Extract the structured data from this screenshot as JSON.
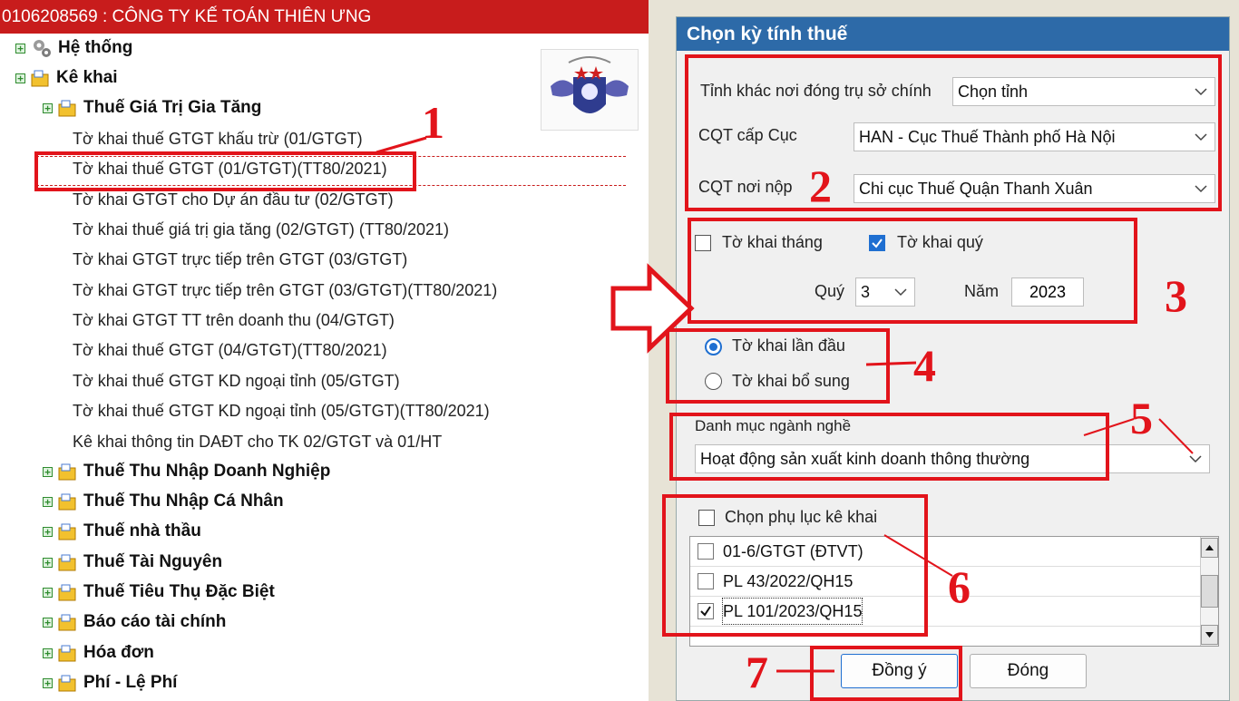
{
  "left_panel": {
    "title": "0106208569 : CÔNG TY KẾ TOÁN THIÊN ƯNG",
    "tree": {
      "he_thong": "Hệ thống",
      "ke_khai": "Kê khai",
      "gtgt_group": "Thuế Giá Trị Gia Tăng",
      "gtgt_items": [
        "Tờ khai thuế GTGT khấu trừ (01/GTGT)",
        "Tờ khai thuế GTGT (01/GTGT)(TT80/2021)",
        "Tờ khai GTGT cho Dự án đầu tư (02/GTGT)",
        "Tờ khai thuế giá trị gia tăng (02/GTGT) (TT80/2021)",
        "Tờ khai GTGT trực tiếp trên GTGT (03/GTGT)",
        "Tờ khai GTGT trực tiếp trên GTGT (03/GTGT)(TT80/2021)",
        "Tờ khai GTGT TT trên doanh thu (04/GTGT)",
        "Tờ khai thuế GTGT (04/GTGT)(TT80/2021)",
        "Tờ khai thuế GTGT KD ngoại tỉnh (05/GTGT)",
        "Tờ khai thuế GTGT KD ngoại tỉnh (05/GTGT)(TT80/2021)",
        "Kê khai thông tin DAĐT cho TK 02/GTGT và 01/HT"
      ],
      "groups": [
        "Thuế Thu Nhập Doanh Nghiệp",
        "Thuế Thu Nhập Cá Nhân",
        "Thuế nhà thầu",
        "Thuế Tài Nguyên",
        "Thuế Tiêu Thụ Đặc Biệt",
        "Báo cáo tài chính",
        "Hóa đơn",
        "Phí - Lệ Phí"
      ]
    }
  },
  "dialog": {
    "title": "Chọn kỳ tính thuế",
    "tinh_label": "Tỉnh khác nơi đóng trụ sở chính",
    "tinh_value": "Chọn tỉnh",
    "cqt_cuc_label": "CQT cấp Cục",
    "cqt_cuc_value": "HAN - Cục Thuế Thành phố Hà Nội",
    "cqt_nop_label": "CQT nơi nộp",
    "cqt_nop_value": "Chi cục Thuế Quận Thanh Xuân",
    "to_khai_thang": "Tờ khai tháng",
    "to_khai_quy": "Tờ khai quý",
    "quy_label": "Quý",
    "quy_value": "3",
    "nam_label": "Năm",
    "nam_value": "2023",
    "lan_dau": "Tờ khai lần đầu",
    "bo_sung": "Tờ khai bổ sung",
    "danh_muc_label": "Danh mục ngành nghề",
    "danh_muc_value": "Hoạt động sản xuất kinh doanh thông thường",
    "chon_phu_luc": "Chọn phụ lục kê khai",
    "phu_luc": [
      "01-6/GTGT (ĐTVT)",
      "PL 43/2022/QH15",
      "PL 101/2023/QH15"
    ],
    "btn_dong_y": "Đồng ý",
    "btn_dong": "Đóng"
  },
  "annotations": [
    "1",
    "2",
    "3",
    "4",
    "5",
    "6",
    "7"
  ],
  "colors": {
    "title_bar_red": "#c81c1c",
    "dialog_title_blue": "#2d6aa8",
    "annotation_red": "#e2141b",
    "check_blue": "#1f6fd1"
  }
}
